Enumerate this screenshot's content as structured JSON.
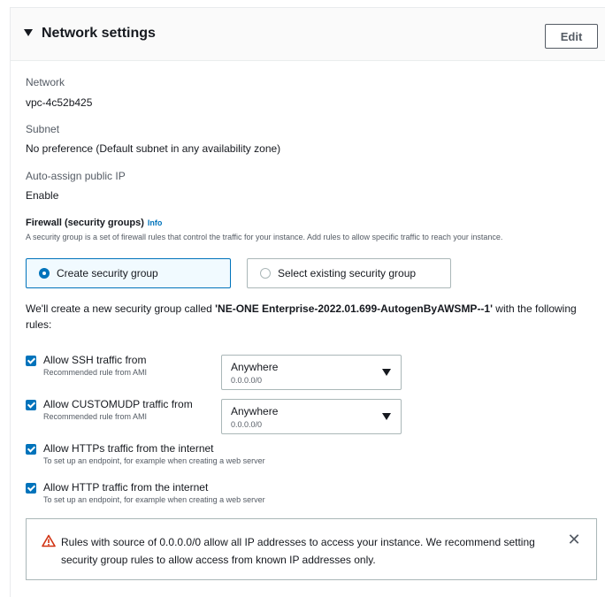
{
  "panel": {
    "title": "Network settings",
    "edit_label": "Edit"
  },
  "fields": [
    {
      "label": "Network",
      "value": "vpc-4c52b425"
    },
    {
      "label": "Subnet",
      "value": "No preference (Default subnet in any availability zone)"
    },
    {
      "label": "Auto-assign public IP",
      "value": "Enable"
    }
  ],
  "firewall": {
    "title": "Firewall (security groups)",
    "info_label": "Info",
    "description": "A security group is a set of firewall rules that control the traffic for your instance. Add rules to allow specific traffic to reach your instance.",
    "options": [
      {
        "label": "Create security group",
        "selected": true
      },
      {
        "label": "Select existing security group",
        "selected": false
      }
    ],
    "create_text_prefix": "We'll create a new security group called ",
    "group_name": "'NE-ONE Enterprise-2022.01.699-AutogenByAWSMP--1'",
    "create_text_suffix": " with the following rules:"
  },
  "rules": [
    {
      "label": "Allow SSH traffic from",
      "sub": "Recommended rule from AMI",
      "checked": true,
      "select": {
        "value": "Anywhere",
        "sub": "0.0.0.0/0"
      }
    },
    {
      "label": "Allow CUSTOMUDP traffic from",
      "sub": "Recommended rule from AMI",
      "checked": true,
      "select": {
        "value": "Anywhere",
        "sub": "0.0.0.0/0"
      }
    },
    {
      "label": "Allow HTTPs traffic from the internet",
      "sub": "To set up an endpoint, for example when creating a web server",
      "checked": true
    },
    {
      "label": "Allow HTTP traffic from the internet",
      "sub": "To set up an endpoint, for example when creating a web server",
      "checked": true
    }
  ],
  "alert": {
    "text": "Rules with source of 0.0.0.0/0 allow all IP addresses to access your instance. We recommend setting security group rules to allow access from known IP addresses only.",
    "icon": "warning-icon",
    "close_icon": "close-icon",
    "warning_color": "#d13212"
  },
  "colors": {
    "accent": "#0073bb",
    "text": "#16191f",
    "muted": "#545b64",
    "border": "#aab7b8"
  }
}
